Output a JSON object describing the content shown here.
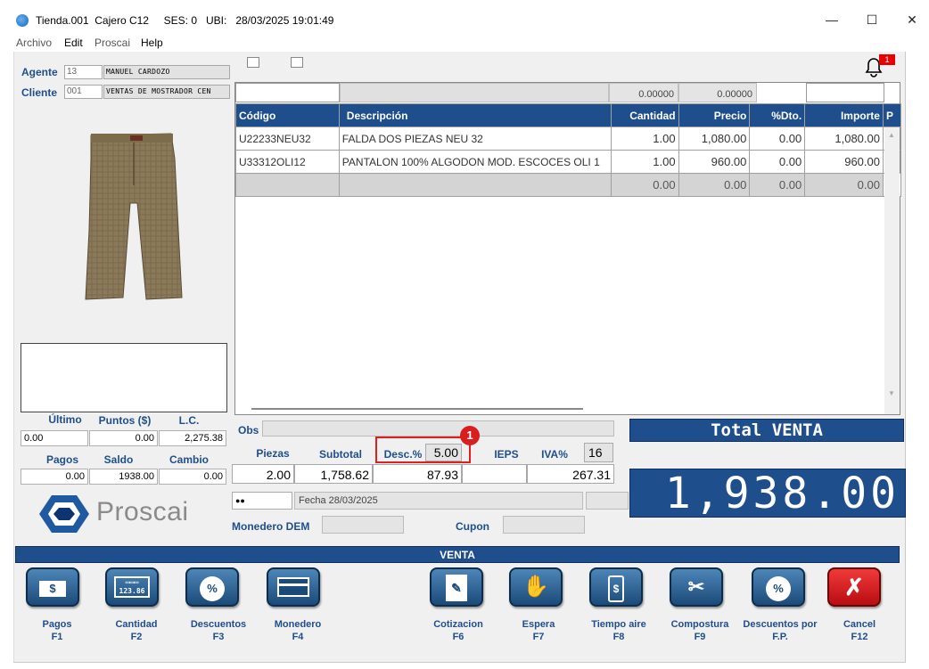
{
  "window": {
    "title": "Tienda.001  Cajero C12     SES: 0   UBI:   28/03/2025 19:01:49",
    "minimize": "—",
    "maximize": "☐",
    "close": "✕"
  },
  "menu": [
    "Archivo",
    "Edit",
    "Proscai",
    "Help"
  ],
  "notifications": {
    "count": "1"
  },
  "agente": {
    "label": "Agente",
    "code": "13",
    "name": "MANUEL CARDOZO"
  },
  "cliente": {
    "label": "Cliente",
    "code": "001",
    "name": "VENTAS DE MOSTRADOR CEN"
  },
  "grid": {
    "top_values": [
      "0.00000",
      "0.00000"
    ],
    "headers": [
      "Código",
      "Descripción",
      "Cantidad",
      "Precio",
      "%Dto.",
      "Importe",
      "P"
    ],
    "rows": [
      {
        "codigo": "U22233NEU32",
        "descripcion": "FALDA DOS PIEZAS NEU 32",
        "cantidad": "1.00",
        "precio": "1,080.00",
        "dto": "0.00",
        "importe": "1,080.00"
      },
      {
        "codigo": "U33312OLI12",
        "descripcion": "PANTALON 100%  ALGODON MOD. ESCOCES OLI 1",
        "cantidad": "1.00",
        "precio": "960.00",
        "dto": "0.00",
        "importe": "960.00"
      }
    ],
    "empty_row": {
      "cantidad": "0.00",
      "precio": "0.00",
      "dto": "0.00",
      "importe": "0.00"
    }
  },
  "left_stats": {
    "ultimo_label": "Último",
    "puntos_label": "Puntos ($)",
    "lc_label": "L.C.",
    "ultimo": "0.00",
    "puntos": "0.00",
    "lc": "2,275.38",
    "pagos_label": "Pagos",
    "saldo_label": "Saldo",
    "cambio_label": "Cambio",
    "pagos": "0.00",
    "saldo": "1938.00",
    "cambio": "0.00"
  },
  "brand": {
    "name": "Proscai"
  },
  "totals": {
    "obs_label": "Obs",
    "piezas_label": "Piezas",
    "subtotal_label": "Subtotal",
    "desc_label": "Desc.%",
    "desc_pct": "5.00",
    "ieps_label": "IEPS",
    "iva_label": "IVA%",
    "iva_pct": "16",
    "piezas": "2.00",
    "subtotal": "1,758.62",
    "descuento": "87.93",
    "iva": "267.31",
    "password": "●●",
    "fecha": "Fecha 28/03/2025",
    "monedero_label": "Monedero DEM",
    "cupon_label": "Cupon",
    "total_label": "Total VENTA",
    "total": "1,938.00",
    "badge": "1"
  },
  "section_title": "VENTA",
  "toolbar": [
    {
      "label": "Pagos",
      "key": "F1",
      "icon": "dollar-bill-icon"
    },
    {
      "label": "Cantidad",
      "key": "F2",
      "icon": "calculator-icon"
    },
    {
      "label": "Descuentos",
      "key": "F3",
      "icon": "percent-badge-icon"
    },
    {
      "label": "Monedero",
      "key": "F4",
      "icon": "wallet-card-icon"
    },
    {
      "label": "Cotizacion",
      "key": "F6",
      "icon": "quote-document-icon"
    },
    {
      "label": "Espera",
      "key": "F7",
      "icon": "hand-icon"
    },
    {
      "label": "Tiempo aire",
      "key": "F8",
      "icon": "phone-dollar-icon"
    },
    {
      "label": "Compostura",
      "key": "F9",
      "icon": "scissors-icon"
    },
    {
      "label": "Descuentos por",
      "key": "F.P.",
      "icon": "percent-badge-icon"
    },
    {
      "label": "Cancel",
      "key": "F12",
      "icon": "cancel-x-icon"
    }
  ],
  "colors": {
    "accent": "#1f4e8c",
    "cancel": "#d9141c",
    "highlight": "#e02020"
  }
}
